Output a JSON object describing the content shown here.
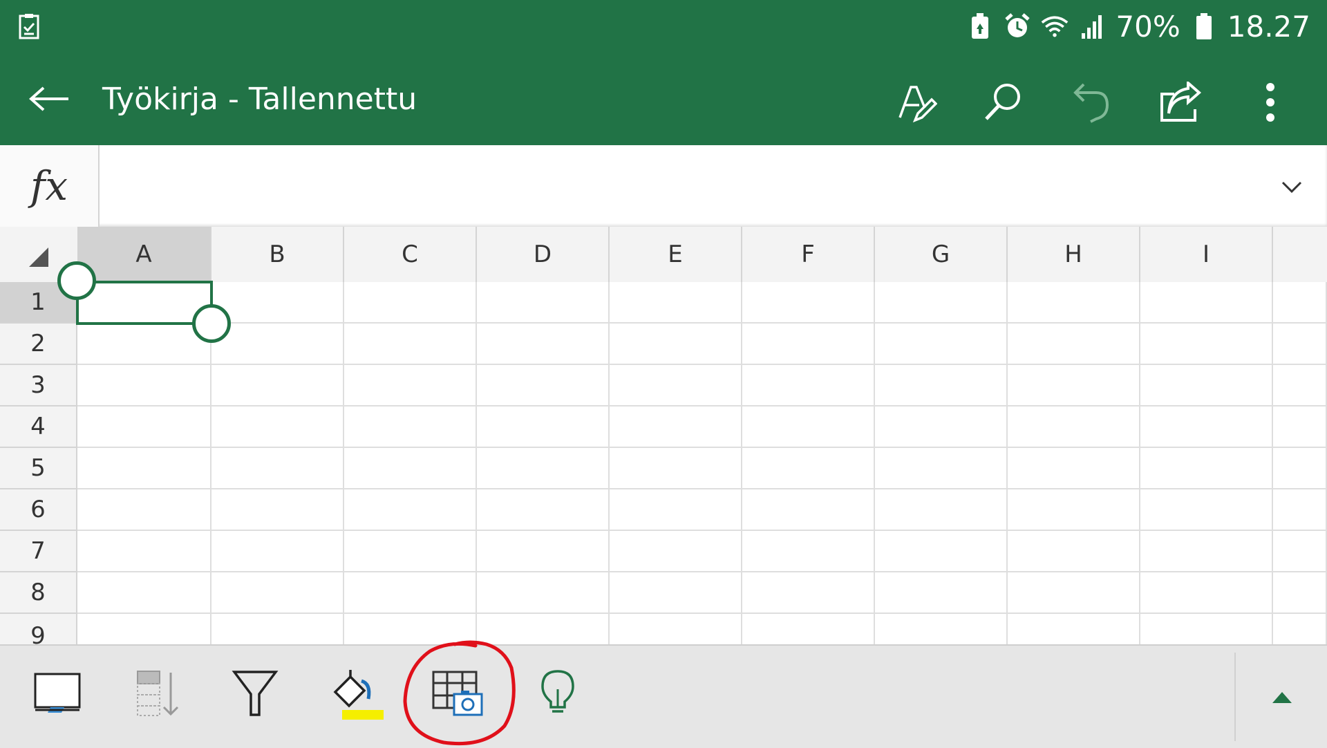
{
  "status_bar": {
    "battery_percent": "70%",
    "time": "18.27",
    "icons": [
      "checklist-icon",
      "battery-saver-icon",
      "alarm-icon",
      "wifi-icon",
      "signal-icon",
      "battery-icon"
    ]
  },
  "app_bar": {
    "title": "Työkirja - Tallennettu",
    "actions": [
      "draw-icon",
      "search-icon",
      "undo-icon",
      "share-icon",
      "more-vert-icon"
    ]
  },
  "formula_bar": {
    "fx_label": "fx",
    "value": "",
    "placeholder": ""
  },
  "sheet": {
    "columns": [
      "A",
      "B",
      "C",
      "D",
      "E",
      "F",
      "G",
      "H",
      "I"
    ],
    "rows": [
      "1",
      "2",
      "3",
      "4",
      "5",
      "6",
      "7",
      "8",
      "9"
    ],
    "selected_cell": "A1"
  },
  "bottom_toolbar": {
    "buttons": [
      "select-icon",
      "sort-icon",
      "filter-icon",
      "fill-color-icon",
      "table-from-picture-icon",
      "ideas-icon",
      "expand-toolbar-icon"
    ],
    "highlight_color": "#f5ef00",
    "annotation_color": "#e0101a"
  },
  "colors": {
    "accent": "#217346",
    "grid_header": "#f3f3f3",
    "selected_header": "#d2d2d2"
  }
}
